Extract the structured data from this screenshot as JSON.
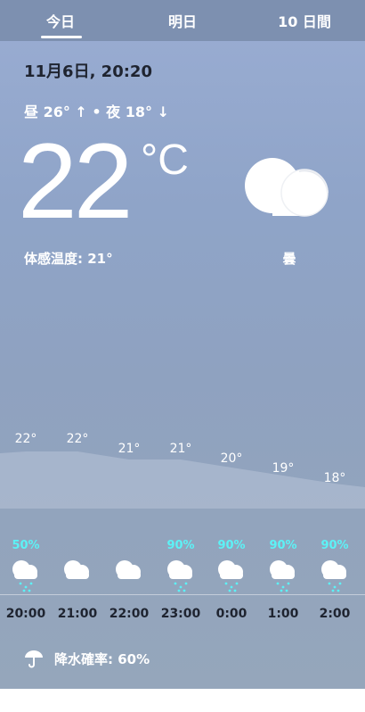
{
  "tabs": [
    {
      "label": "今日",
      "selected": true
    },
    {
      "label": "明日",
      "selected": false
    },
    {
      "label": "10 日間",
      "selected": false
    }
  ],
  "current": {
    "datetime": "11月6日, 20:20",
    "high_low": "昼 26° ↑ • 夜 18° ↓",
    "temperature": "22",
    "unit": "°C",
    "feels_like": "体感温度: 21°",
    "condition": "曇",
    "condition_icon": "cloud-icon"
  },
  "hourly": [
    {
      "hour": "20:00",
      "temp_label": "22°",
      "temp": 22,
      "precip": "50%",
      "icon": "rain-cloud-icon"
    },
    {
      "hour": "21:00",
      "temp_label": "22°",
      "temp": 22,
      "precip": "",
      "icon": "cloud-icon"
    },
    {
      "hour": "22:00",
      "temp_label": "21°",
      "temp": 21,
      "precip": "",
      "icon": "cloud-icon"
    },
    {
      "hour": "23:00",
      "temp_label": "21°",
      "temp": 21,
      "precip": "90%",
      "icon": "rain-cloud-icon"
    },
    {
      "hour": "0:00",
      "temp_label": "20°",
      "temp": 20,
      "precip": "90%",
      "icon": "rain-cloud-icon"
    },
    {
      "hour": "1:00",
      "temp_label": "19°",
      "temp": 19,
      "precip": "90%",
      "icon": "rain-cloud-icon"
    },
    {
      "hour": "2:00",
      "temp_label": "18°",
      "temp": 18,
      "precip": "90%",
      "icon": "rain-cloud-icon"
    }
  ],
  "precipitation": {
    "label": "降水確率: 60%",
    "icon": "umbrella-icon"
  },
  "colors": {
    "precip_text": "#5cf2f6",
    "dark_text": "#1f2430",
    "tabbar": "#7d90b0"
  }
}
